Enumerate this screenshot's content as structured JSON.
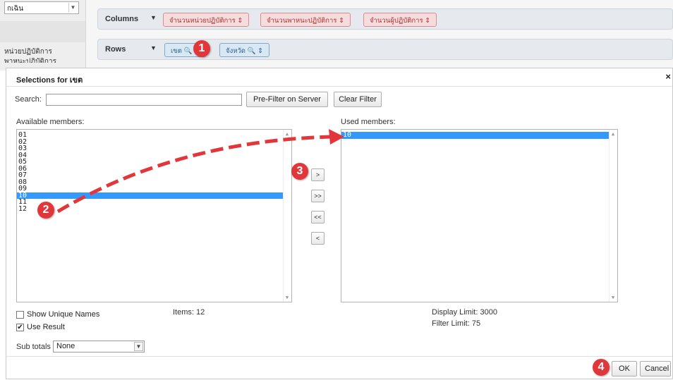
{
  "background": {
    "sidebar": {
      "select_value": "กเฉิน",
      "text_line1": "หน่วยปฏิบัติการ",
      "text_line2": "พาหนะปฏิบัติการ"
    },
    "columns_shelf": {
      "label": "Columns",
      "chips": [
        "จำนวนหน่วยปฏิบัติการ ⇕",
        "จำนวนพาหนะปฏิบัติการ ⇕",
        "จำนวนผู้ปฏิบัติการ ⇕"
      ]
    },
    "rows_shelf": {
      "label": "Rows",
      "chips": [
        "เขต 🔍 ⇕",
        "จังหวัด 🔍 ⇕"
      ]
    }
  },
  "dialog": {
    "title": "Selections for เขต",
    "search": {
      "label": "Search:",
      "value": "",
      "placeholder": ""
    },
    "buttons": {
      "pre_filter": "Pre-Filter on Server",
      "clear_filter": "Clear Filter",
      "move_right": ">",
      "move_all_right": ">>",
      "move_all_left": "<<",
      "move_left": "<",
      "ok": "OK",
      "cancel": "Cancel"
    },
    "available": {
      "label": "Available members:",
      "items": [
        "01",
        "02",
        "03",
        "04",
        "05",
        "06",
        "07",
        "08",
        "09",
        "10",
        "11",
        "12"
      ],
      "selected_index": 9
    },
    "used": {
      "label": "Used members:",
      "items": [
        "10"
      ],
      "selected_index": 0
    },
    "items_count": "Items: 12",
    "display_limit": "Display Limit: 3000",
    "filter_limit": "Filter Limit: 75",
    "show_unique_names": {
      "label": "Show Unique Names",
      "checked": false
    },
    "use_result": {
      "label": "Use Result",
      "checked": true
    },
    "sub_totals": {
      "label": "Sub totals",
      "value": "None"
    }
  },
  "annotations": {
    "markers": [
      "1",
      "2",
      "3",
      "4"
    ],
    "accent_color": "#e2373a"
  }
}
